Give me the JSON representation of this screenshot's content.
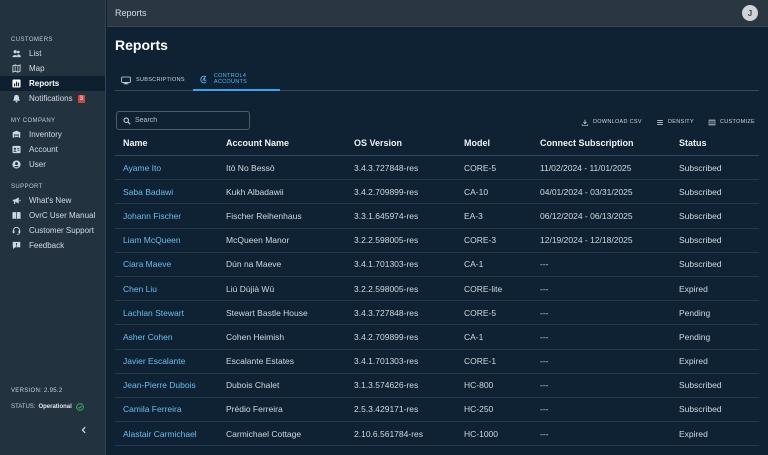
{
  "sidebar": {
    "sections": [
      {
        "title": "CUSTOMERS",
        "items": [
          {
            "label": "List",
            "icon": "people-icon"
          },
          {
            "label": "Map",
            "icon": "map-icon"
          },
          {
            "label": "Reports",
            "icon": "reports-icon",
            "active": true
          },
          {
            "label": "Notifications",
            "icon": "bell-icon",
            "badge": "3"
          }
        ]
      },
      {
        "title": "MY COMPANY",
        "items": [
          {
            "label": "Inventory",
            "icon": "inventory-icon"
          },
          {
            "label": "Account",
            "icon": "account-icon"
          },
          {
            "label": "User",
            "icon": "user-icon"
          }
        ]
      },
      {
        "title": "SUPPORT",
        "items": [
          {
            "label": "What's New",
            "icon": "megaphone-icon"
          },
          {
            "label": "OvrC User Manual",
            "icon": "book-icon"
          },
          {
            "label": "Customer Support",
            "icon": "support-icon"
          },
          {
            "label": "Feedback",
            "icon": "feedback-icon"
          }
        ]
      }
    ],
    "version_label": "VERSION: 2.95.2",
    "status_label": "STATUS:",
    "status_value": "Operational",
    "status_color": "#3fbf5a"
  },
  "topbar": {
    "title": "Reports",
    "avatar_initial": "J"
  },
  "page": {
    "title": "Reports"
  },
  "tabs": [
    {
      "label": "SUBSCRIPTIONS",
      "icon": "monitor-icon"
    },
    {
      "label": "CONTROL4 ACCOUNTS",
      "icon": "control4-icon",
      "active": true
    }
  ],
  "search": {
    "placeholder": "Search",
    "value": ""
  },
  "actions": {
    "download": "DOWNLOAD CSV",
    "density": "DENSITY",
    "customize": "CUSTOMIZE"
  },
  "accent_color": "#3aa5ea",
  "table": {
    "headers": [
      "Name",
      "Account Name",
      "OS Version",
      "Model",
      "Connect Subscription",
      "Status"
    ],
    "rows": [
      [
        "Ayame Ito",
        "Itō No Bessō",
        "3.4.3.727848-res",
        "CORE-5",
        "11/02/2024 - 11/01/2025",
        "Subscribed"
      ],
      [
        "Saba Badawi",
        "Kukh Albadawii",
        "3.4.2.709899-res",
        "CA-10",
        "04/01/2024 - 03/31/2025",
        "Subscribed"
      ],
      [
        "Johann Fischer",
        "Fischer Reihenhaus",
        "3.3.1.645974-res",
        "EA-3",
        "06/12/2024 - 06/13/2025",
        "Subscribed"
      ],
      [
        "Liam McQueen",
        "McQueen Manor",
        "3.2.2.598005-res",
        "CORE-3",
        "12/19/2024 - 12/18/2025",
        "Subscribed"
      ],
      [
        "Ciara Maeve",
        "Dún na Maeve",
        "3.4.1.701303-res",
        "CA-1",
        "---",
        "Subscribed"
      ],
      [
        "Chen Liu",
        "Liú Dùjià Wū",
        "3.2.2.598005-res",
        "CORE-lite",
        "---",
        "Expired"
      ],
      [
        "Lachlan Stewart",
        "Stewart Bastle House",
        "3.4.3.727848-res",
        "CORE-5",
        "---",
        "Pending"
      ],
      [
        "Asher Cohen",
        "Cohen Heimish",
        "3.4.2.709899-res",
        "CA-1",
        "---",
        "Pending"
      ],
      [
        "Javier Escalante",
        "Escalante Estates",
        "3.4.1.701303-res",
        "CORE-1",
        "---",
        "Expired"
      ],
      [
        "Jean-Pierre Dubois",
        "Dubois Chalet",
        "3.1.3.574626-res",
        "HC-800",
        "---",
        "Subscribed"
      ],
      [
        "Camila Ferreira",
        "Prédio Ferreira",
        "2.5.3.429171-res",
        "HC-250",
        "---",
        "Subscribed"
      ],
      [
        "Alastair Carmichael",
        "Carmichael Cottage",
        "2.10.6.561784-res",
        "HC-1000",
        "---",
        "Expired"
      ]
    ]
  }
}
